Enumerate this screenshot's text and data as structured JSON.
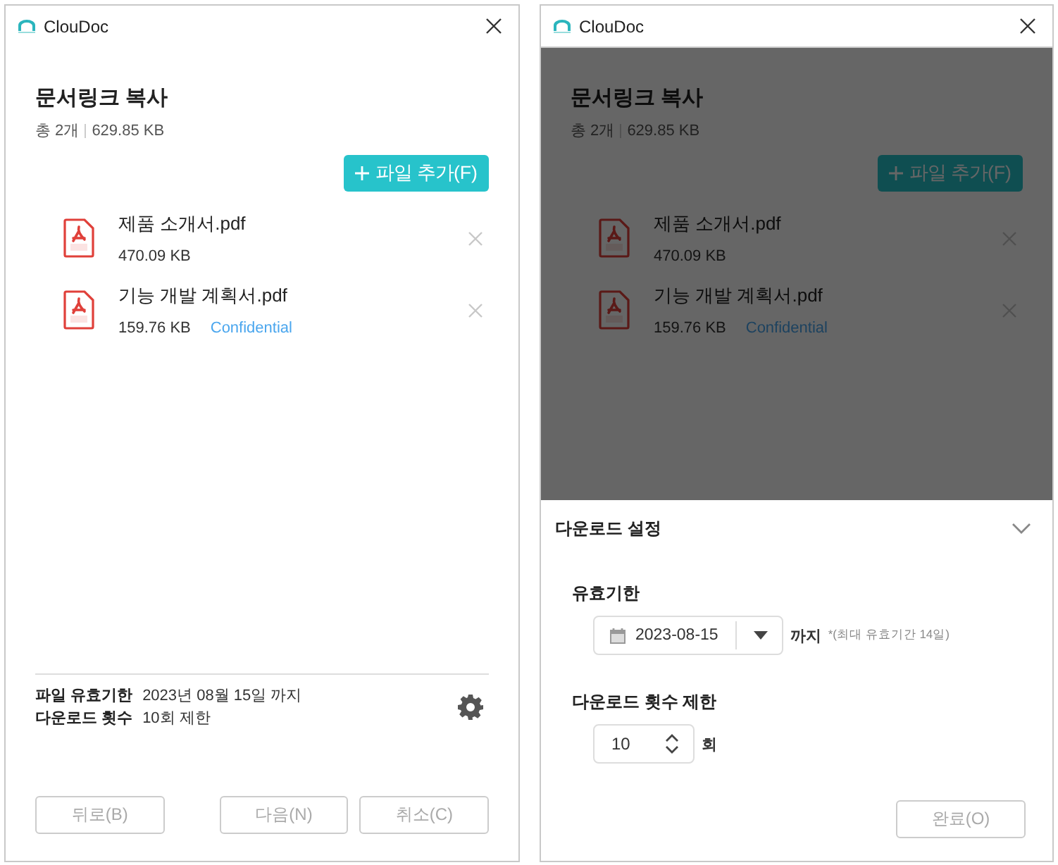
{
  "windows": [
    {
      "title": "ClouDoc",
      "kind": "summary",
      "heading": "문서링크 복사",
      "count": "총 2개",
      "total_size": "629.85 KB",
      "add_button": "파일 추가(F)",
      "files": [
        {
          "name": "제품 소개서.pdf",
          "size": "470.09 KB"
        },
        {
          "name": "기능 개발 계획서.pdf",
          "size": "159.76 KB",
          "tag": "Confidential"
        }
      ],
      "footer": {
        "rows": [
          {
            "label": "파일 유효기한",
            "value": "2023년 08월 15일 까지"
          },
          {
            "label": "다운로드 횟수",
            "value": "10회 제한"
          }
        ],
        "buttons": [
          {
            "label": "뒤로(B)",
            "disabled": true
          },
          {
            "label": "다음(N)",
            "disabled": true
          },
          {
            "label": "취소(C)",
            "disabled": true
          }
        ]
      }
    },
    {
      "title": "ClouDoc",
      "kind": "settings",
      "dimmed": true,
      "heading": "문서링크 복사",
      "count": "총 2개",
      "total_size": "629.85 KB",
      "add_button": "파일 추가(F)",
      "files": [
        {
          "name": "제품 소개서.pdf",
          "size": "470.09 KB"
        },
        {
          "name": "기능 개발 계획서.pdf",
          "size": "159.76 KB",
          "tag": "Confidential"
        }
      ],
      "panel": {
        "title": "다운로드 설정",
        "expiry_label": "유효기한",
        "date": "2023-08-15",
        "date_suffix": "까지",
        "date_note": "*(최대 유효기간 14일)",
        "limit_label": "다운로드 횟수 제한",
        "limit_value": "10",
        "limit_unit": "회",
        "done_button": {
          "label": "완료(O)",
          "disabled": true
        }
      }
    }
  ]
}
